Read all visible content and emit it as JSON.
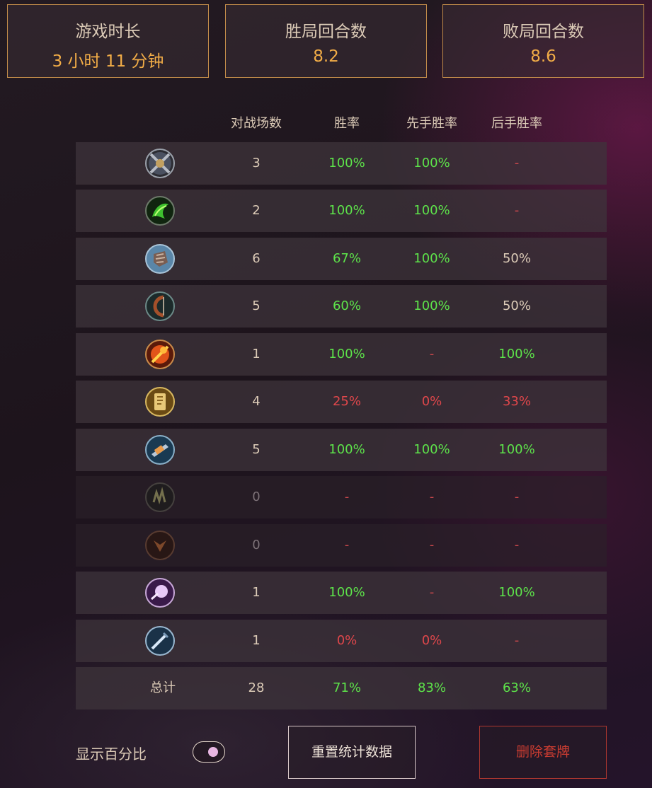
{
  "summary": [
    {
      "label": "游戏时长",
      "value": "3 小时 11 分钟"
    },
    {
      "label": "胜局回合数",
      "value": "8.2"
    },
    {
      "label": "败局回合数",
      "value": "8.6"
    }
  ],
  "table": {
    "headers": [
      "对战场数",
      "胜率",
      "先手胜率",
      "后手胜率"
    ],
    "rows": [
      {
        "icon": "warrior-class-icon",
        "games": "3",
        "winrate": "100%",
        "first": "100%",
        "second": "-"
      },
      {
        "icon": "druid-class-icon",
        "games": "2",
        "winrate": "100%",
        "first": "100%",
        "second": "-"
      },
      {
        "icon": "shaman-class-icon",
        "games": "6",
        "winrate": "67%",
        "first": "100%",
        "second": "50%"
      },
      {
        "icon": "hunter-class-icon",
        "games": "5",
        "winrate": "60%",
        "first": "100%",
        "second": "50%"
      },
      {
        "icon": "mage-class-icon",
        "games": "1",
        "winrate": "100%",
        "first": "-",
        "second": "100%"
      },
      {
        "icon": "paladin-class-icon",
        "games": "4",
        "winrate": "25%",
        "first": "0%",
        "second": "33%"
      },
      {
        "icon": "rogue-class-icon",
        "games": "5",
        "winrate": "100%",
        "first": "100%",
        "second": "100%"
      },
      {
        "icon": "warlock-class-icon",
        "games": "0",
        "winrate": "-",
        "first": "-",
        "second": "-"
      },
      {
        "icon": "demon-hunter-class-icon",
        "games": "0",
        "winrate": "-",
        "first": "-",
        "second": "-"
      },
      {
        "icon": "priest-class-icon",
        "games": "1",
        "winrate": "100%",
        "first": "-",
        "second": "100%"
      },
      {
        "icon": "death-knight-class-icon",
        "games": "1",
        "winrate": "0%",
        "first": "0%",
        "second": "-"
      }
    ],
    "total": {
      "label": "总计",
      "games": "28",
      "winrate": "71%",
      "first": "83%",
      "second": "63%"
    }
  },
  "footer": {
    "show_percent_label": "显示百分比",
    "reset_label": "重置统计数据",
    "delete_label": "删除套牌"
  },
  "colors": {
    "accent": "#f2ad47",
    "win": "#5de34a",
    "loss": "#e0474b",
    "danger": "#c93c31"
  }
}
